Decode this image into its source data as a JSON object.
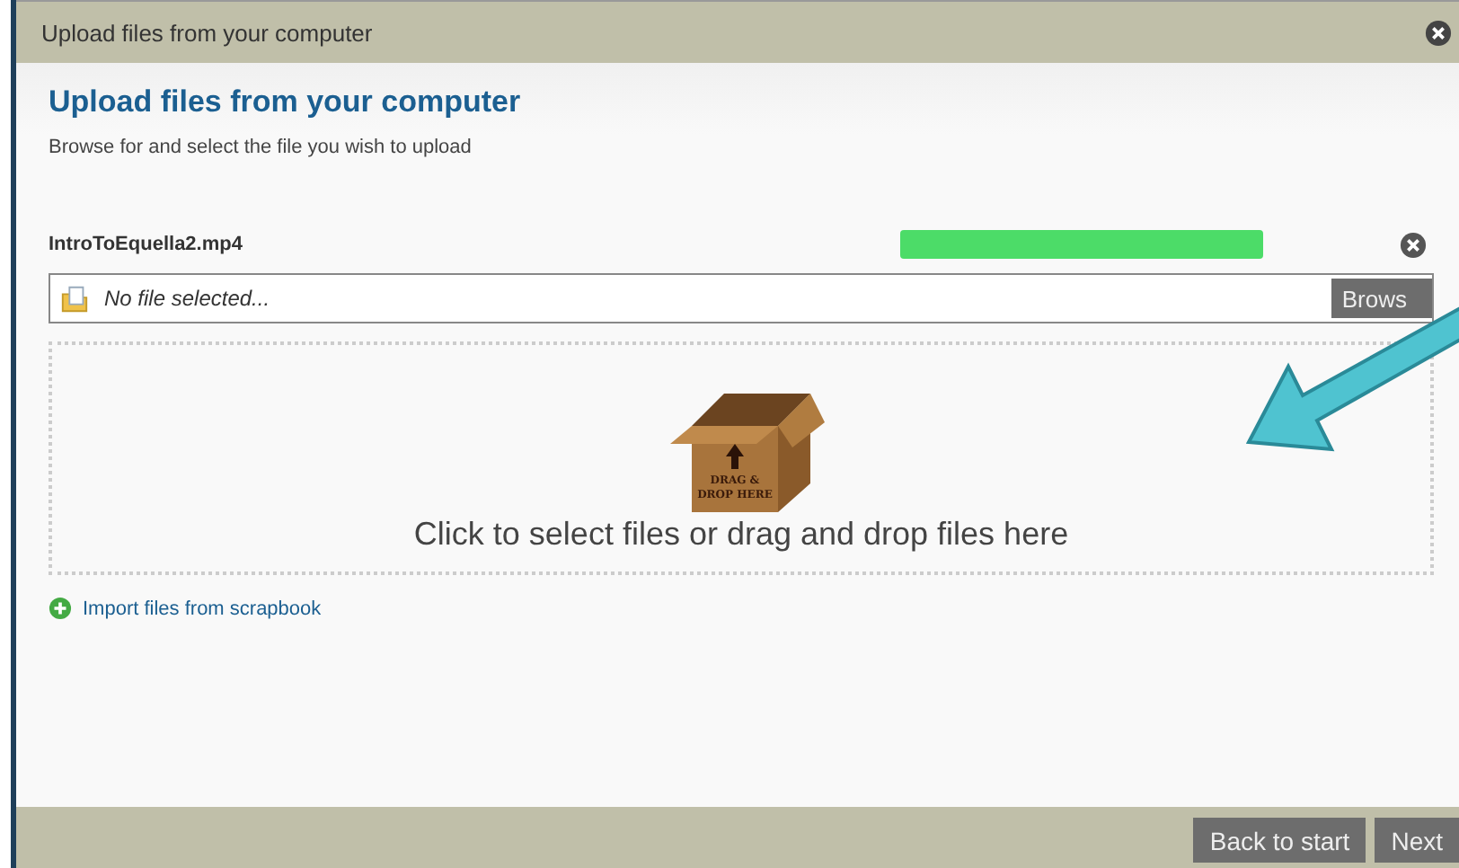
{
  "window": {
    "title": "Upload files from your computer"
  },
  "heading": "Upload files from your computer",
  "description": "Browse for and select the file you wish to upload",
  "uploads": [
    {
      "file_name": "IntroToEquella2.mp4",
      "level": 1
    }
  ],
  "file_field": {
    "placeholder": "No file selected...",
    "button": "Brows"
  },
  "drop_zone": {
    "box_label": [
      "DRAG &",
      "DROP HERE"
    ],
    "text": "Click to select files or drag and drop files here"
  },
  "scrapbook_link": "Import files from scrapbook",
  "footer_buttons": [
    "Back to start",
    "Next"
  ]
}
